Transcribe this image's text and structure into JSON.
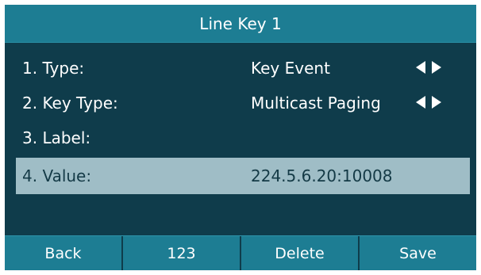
{
  "title": "Line Key 1",
  "rows": [
    {
      "label": "1. Type:",
      "value": "Key Event",
      "has_arrows": true
    },
    {
      "label": "2. Key Type:",
      "value": "Multicast Paging",
      "has_arrows": true
    },
    {
      "label": "3. Label:",
      "value": "",
      "has_arrows": false
    },
    {
      "label": "4. Value:",
      "value": "224.5.6.20:10008",
      "has_arrows": false,
      "selected": true
    }
  ],
  "softkeys": [
    "Back",
    "123",
    "Delete",
    "Save"
  ],
  "colors": {
    "background": "#0f3c4b",
    "title_bar": "#1d7d93",
    "selected_row": "#9fbdc6",
    "softkey_bar": "#1d7d93"
  },
  "icons": {
    "arrow_left": "left-arrow-icon",
    "arrow_right": "right-arrow-icon"
  }
}
